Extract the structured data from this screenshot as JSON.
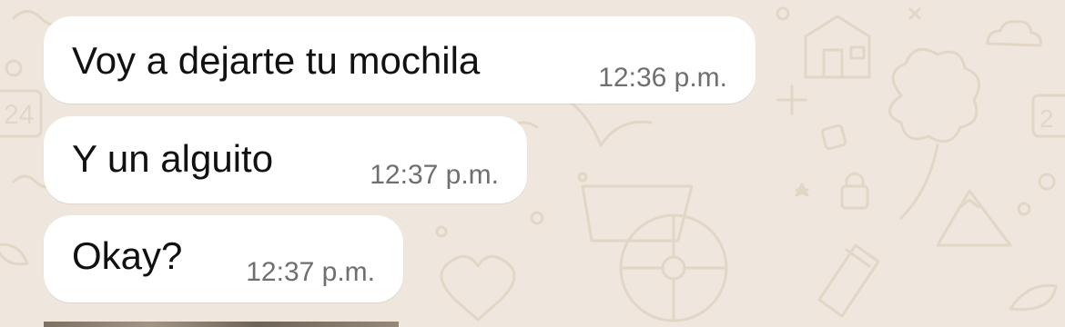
{
  "wallpaper": {
    "color": "#efe7dd",
    "doodle_color": "#e2d7c6"
  },
  "messages": [
    {
      "text": "Voy a dejarte tu mochila",
      "time": "12:36 p.m."
    },
    {
      "text": "Y un alguito",
      "time": "12:37 p.m."
    },
    {
      "text": "Okay?",
      "time": "12:37 p.m."
    }
  ]
}
